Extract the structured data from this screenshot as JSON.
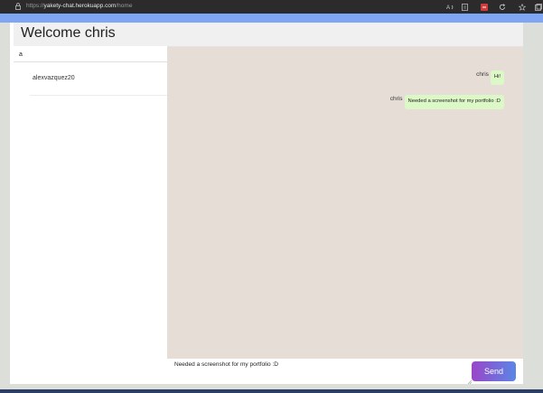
{
  "browser": {
    "url_prefix": "https://",
    "url_domain": "yakety-chat.herokuapp.com",
    "url_path": "/home",
    "toolbar_icons": [
      "read-aloud-icon",
      "reading-view-icon",
      "extension-icon",
      "refresh-icon",
      "favorite-icon",
      "collections-icon"
    ]
  },
  "app": {
    "welcome": "Welcome chris",
    "search_value": "a",
    "users": [
      {
        "name": "alexvazquez20"
      }
    ],
    "messages": [
      {
        "sender": "chris",
        "text": "Hi!"
      },
      {
        "sender": "chris",
        "text": "Needed a screenshot for my portfolio :D"
      }
    ],
    "message_input": "Needed a screenshot for my portfolio :D",
    "send_label": "Send"
  },
  "colors": {
    "accent_blue": "#7ea6f2",
    "chat_background": "#e6ddd6",
    "bubble": "#dcf8c6",
    "send_gradient_start": "#9a46c8",
    "send_gradient_end": "#5a86e6"
  }
}
